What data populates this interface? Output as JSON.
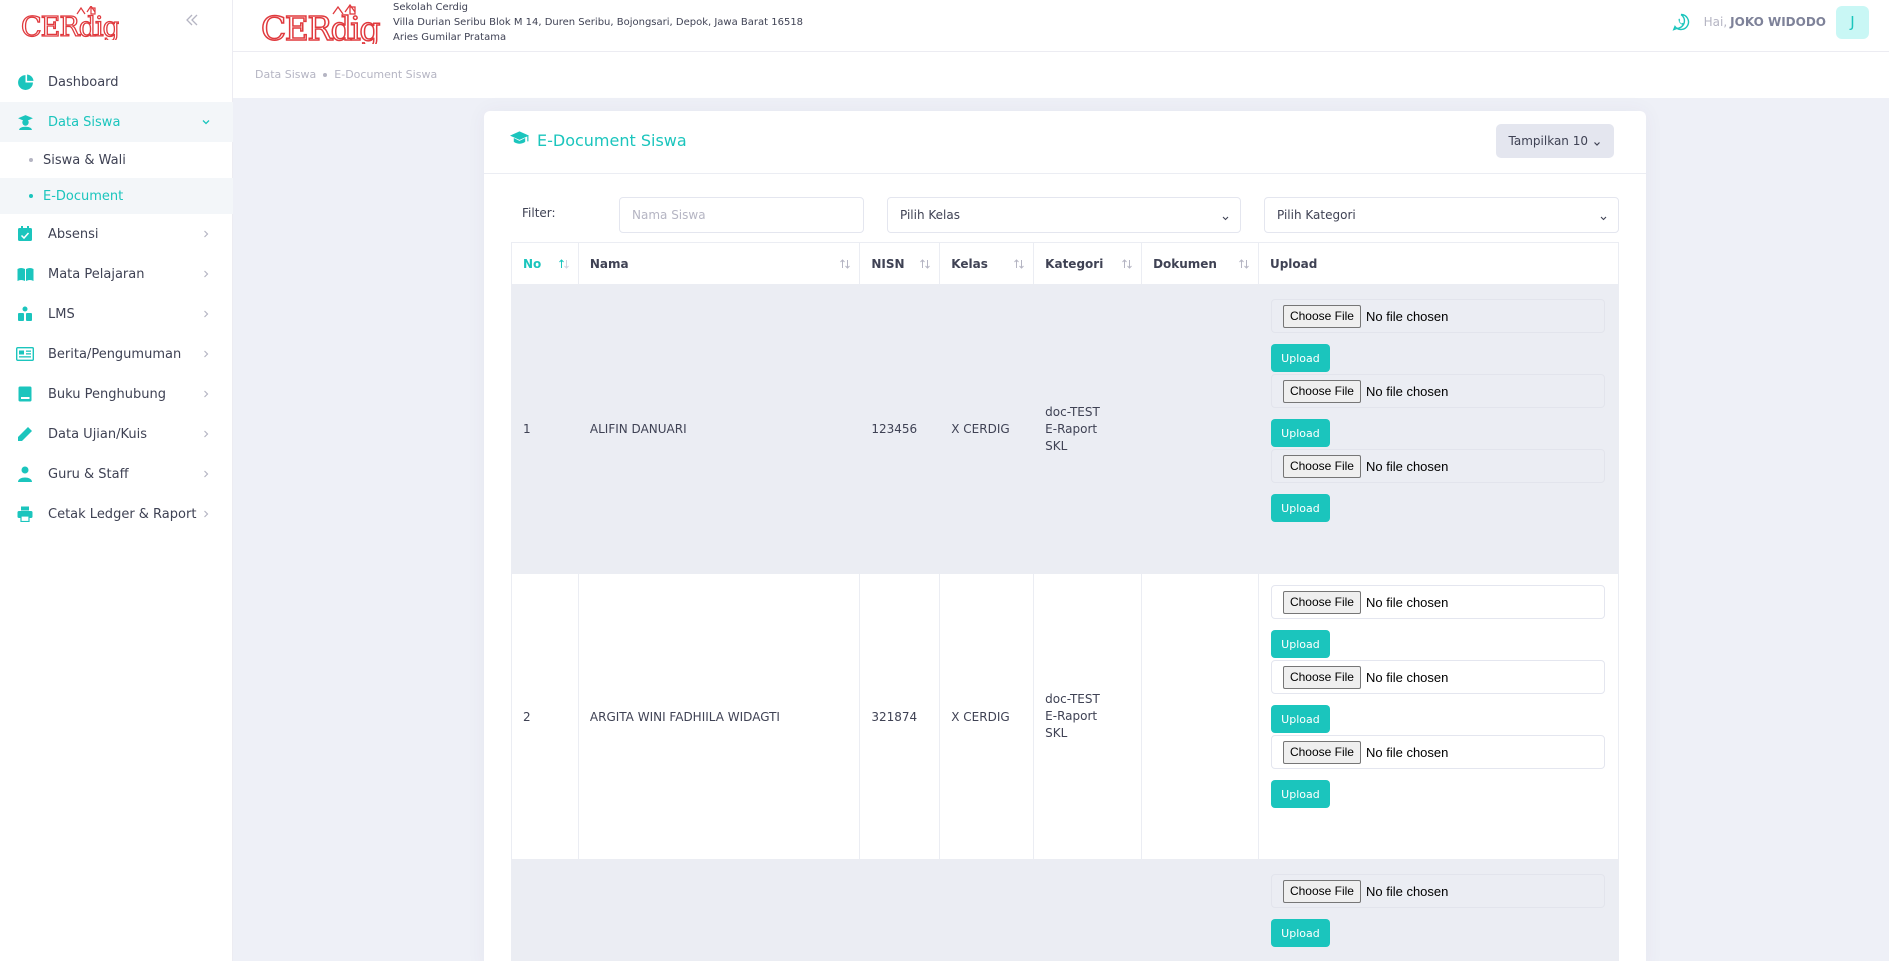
{
  "brand": {
    "logo_text": "CERdig",
    "accent": "#1bc5bd",
    "logo_color": "#e03a3e"
  },
  "header": {
    "school_name": "Sekolah Cerdig",
    "school_address": "Villa Durian Seribu Blok M 14, Duren Seribu, Bojongsari, Depok, Jawa Barat 16518",
    "principal": "Aries Gumilar Pratama",
    "greeting": "Hai,",
    "user_name": "JOKO WIDODO",
    "avatar_letter": "J"
  },
  "sidebar": {
    "items": [
      {
        "label": "Dashboard",
        "icon": "dashboard-icon"
      },
      {
        "label": "Data Siswa",
        "icon": "student-icon"
      },
      {
        "label": "Absensi",
        "icon": "calendar-check-icon"
      },
      {
        "label": "Mata Pelajaran",
        "icon": "book-open-icon"
      },
      {
        "label": "LMS",
        "icon": "people-icon"
      },
      {
        "label": "Berita/Pengumuman",
        "icon": "newspaper-icon"
      },
      {
        "label": "Buku Penghubung",
        "icon": "book-icon"
      },
      {
        "label": "Data Ujian/Kuis",
        "icon": "pencil-icon"
      },
      {
        "label": "Guru & Staff",
        "icon": "user-tie-icon"
      },
      {
        "label": "Cetak Ledger & Raport",
        "icon": "printer-icon"
      }
    ],
    "sub_items": [
      {
        "label": "Siswa & Wali"
      },
      {
        "label": "E-Document"
      }
    ]
  },
  "breadcrumb": [
    "Data Siswa",
    "E-Document Siswa"
  ],
  "card": {
    "title": "E-Document Siswa",
    "show_button": "Tampilkan 10"
  },
  "filter": {
    "label": "Filter:",
    "name_placeholder": "Nama Siswa",
    "class_select": "Pilih Kelas",
    "category_select": "Pilih Kategori"
  },
  "table": {
    "columns": [
      "No",
      "Nama",
      "NISN",
      "Kelas",
      "Kategori",
      "Dokumen",
      "Upload"
    ],
    "rows": [
      {
        "no": "1",
        "nama": "ALIFIN DANUARI",
        "nisn": "123456",
        "kelas": "X CERDIG",
        "kategori": [
          "doc-TEST",
          "E-Raport",
          "SKL"
        ],
        "dokumen": ""
      },
      {
        "no": "2",
        "nama": "ARGITA WINI FADHIILA WIDAGTI",
        "nisn": "321874",
        "kelas": "X CERDIG",
        "kategori": [
          "doc-TEST",
          "E-Raport",
          "SKL"
        ],
        "dokumen": ""
      },
      {
        "no": "",
        "nama": "",
        "nisn": "",
        "kelas": "",
        "kategori": [],
        "dokumen": ""
      }
    ],
    "choose_file_label": "Choose File",
    "no_file_label": "No file chosen",
    "upload_label": "Upload"
  }
}
